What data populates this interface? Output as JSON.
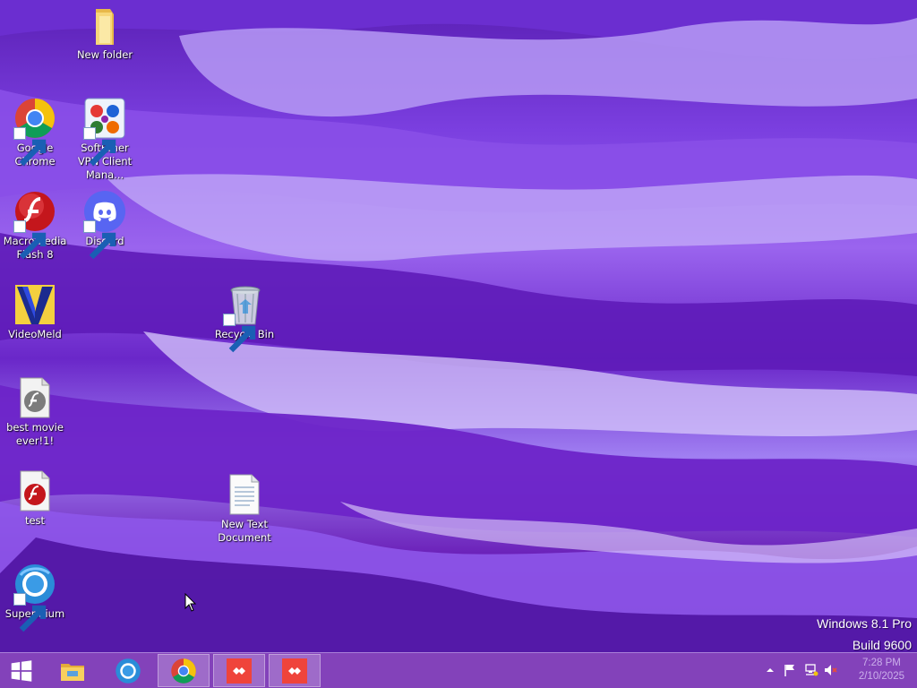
{
  "desktop": {
    "icons": [
      {
        "label": "New folder",
        "icon": "folder-icon",
        "shortcut": false
      },
      {
        "label": "Google Chrome",
        "icon": "chrome-icon",
        "shortcut": true
      },
      {
        "label": "SoftEther VPN Client Mana...",
        "icon": "softether-vpn-icon",
        "shortcut": true
      },
      {
        "label": "Macromedia Flash 8",
        "icon": "flash-icon",
        "shortcut": true
      },
      {
        "label": "Discord",
        "icon": "discord-icon",
        "shortcut": true
      },
      {
        "label": "VideoMeld",
        "icon": "videomeld-icon",
        "shortcut": false
      },
      {
        "label": "Recycle Bin",
        "icon": "recycle-bin-icon",
        "shortcut": true
      },
      {
        "label": "best movie ever!1!",
        "icon": "flash-movie-file-icon",
        "shortcut": false
      },
      {
        "label": "test",
        "icon": "flash-document-file-icon",
        "shortcut": false
      },
      {
        "label": "New Text Document",
        "icon": "text-document-icon",
        "shortcut": false
      },
      {
        "label": "Supermium",
        "icon": "supermium-icon",
        "shortcut": true
      }
    ],
    "accent_color": "#7b3fe0"
  },
  "watermark": {
    "line1": "Windows 8.1 Pro",
    "line2": "Build 9600"
  },
  "taskbar": {
    "buttons": [
      {
        "icon": "windows-start-icon"
      },
      {
        "icon": "file-explorer-icon"
      },
      {
        "icon": "supermium-icon"
      },
      {
        "icon": "chrome-icon",
        "active": true
      },
      {
        "icon": "anydesk-icon"
      },
      {
        "icon": "anydesk-icon"
      }
    ],
    "tray": {
      "icons": [
        "show-hidden-icons-chevron-icon",
        "action-center-flag-icon",
        "network-icon",
        "volume-muted-icon"
      ],
      "time": "7:28 PM",
      "date": "2/10/2025"
    },
    "color": "#7832b4"
  }
}
